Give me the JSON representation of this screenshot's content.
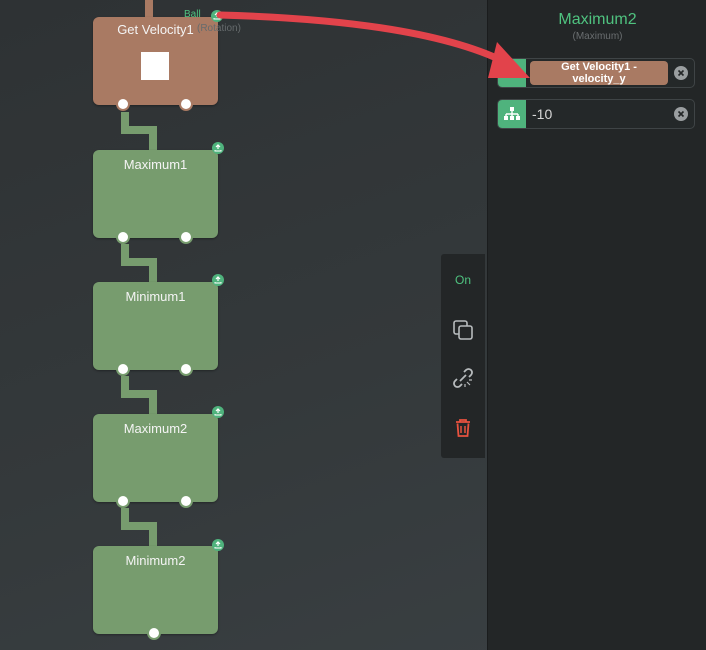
{
  "canvas": {
    "nodes": [
      {
        "title": "Get Velocity1",
        "color": "#a97a63"
      },
      {
        "title": "Maximum1",
        "color": "#779c6e"
      },
      {
        "title": "Minimum1",
        "color": "#779c6e"
      },
      {
        "title": "Maximum2",
        "color": "#779c6e"
      },
      {
        "title": "Minimum2",
        "color": "#779c6e"
      }
    ],
    "export_labels": {
      "primary": "Ball",
      "secondary": "(Rotation)"
    }
  },
  "toolbar": {
    "toggle_label": "On",
    "icons": [
      "duplicate-icon",
      "unlink-icon",
      "trash-icon"
    ]
  },
  "inspector": {
    "title": "Maximum2",
    "subtitle": "(Maximum)",
    "inputs": [
      {
        "icon": "value-input-icon",
        "value": "Get Velocity1 -\nvelocity_y",
        "type": "linked"
      },
      {
        "icon": "hierarchy-icon",
        "value": "-10",
        "type": "number"
      }
    ]
  },
  "colors": {
    "accent": "#4fc27f",
    "brown_node": "#a97a63",
    "green_node": "#779c6e",
    "arrow": "#e2434b",
    "delete": "#e8523f"
  }
}
